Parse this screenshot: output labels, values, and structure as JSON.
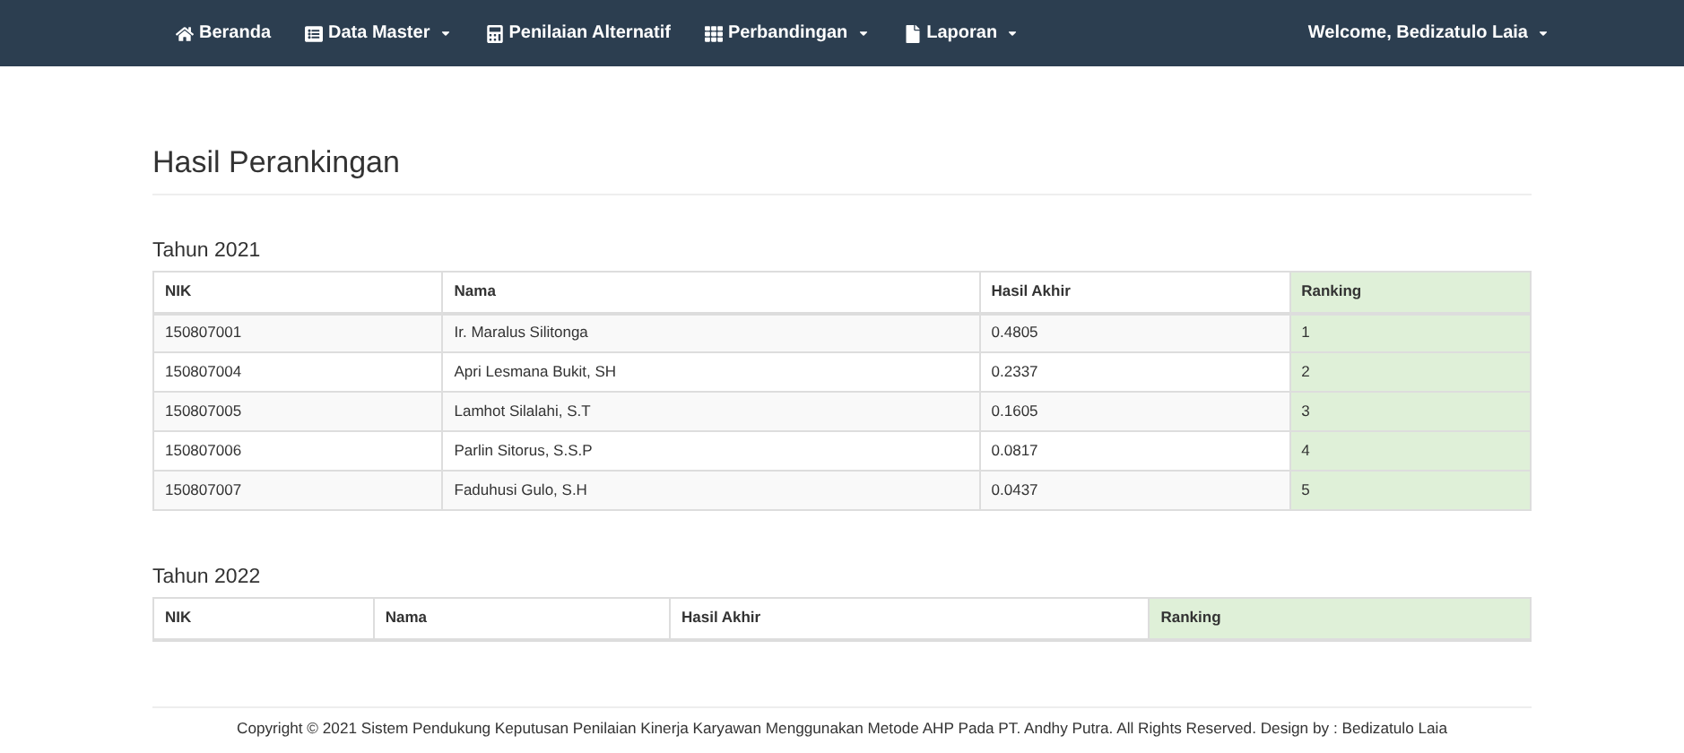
{
  "navbar": {
    "items": [
      {
        "label": "Beranda",
        "dropdown": false
      },
      {
        "label": "Data Master",
        "dropdown": true
      },
      {
        "label": "Penilaian Alternatif",
        "dropdown": false
      },
      {
        "label": "Perbandingan",
        "dropdown": true
      },
      {
        "label": "Laporan",
        "dropdown": true
      }
    ],
    "user": {
      "label": "Welcome, Bedizatulo Laia",
      "dropdown": true
    }
  },
  "page_title": "Hasil Perankingan",
  "sections": [
    {
      "title": "Tahun 2021",
      "columns": [
        {
          "label": "NIK",
          "highlighted": false
        },
        {
          "label": "Nama",
          "highlighted": false
        },
        {
          "label": "Hasil Akhir",
          "highlighted": false
        },
        {
          "label": "Ranking",
          "highlighted": true
        }
      ],
      "rows": [
        [
          "150807001",
          "Ir. Maralus Silitonga",
          "0.4805",
          "1"
        ],
        [
          "150807004",
          "Apri Lesmana Bukit, SH",
          "0.2337",
          "2"
        ],
        [
          "150807005",
          "Lamhot Silalahi, S.T",
          "0.1605",
          "3"
        ],
        [
          "150807006",
          "Parlin Sitorus, S.S.P",
          "0.0817",
          "4"
        ],
        [
          "150807007",
          "Faduhusi Gulo, S.H",
          "0.0437",
          "5"
        ]
      ]
    },
    {
      "title": "Tahun 2022",
      "columns": [
        {
          "label": "NIK",
          "highlighted": false
        },
        {
          "label": "Nama",
          "highlighted": false
        },
        {
          "label": "Hasil Akhir",
          "highlighted": false
        },
        {
          "label": "Ranking",
          "highlighted": true
        }
      ]
    }
  ],
  "footer": "Copyright © 2021 Sistem Pendukung Keputusan Penilaian Kinerja Karyawan Menggunakan Metode AHP Pada PT. Andhy Putra. All Rights Reserved. Design by : Bedizatulo Laia"
}
